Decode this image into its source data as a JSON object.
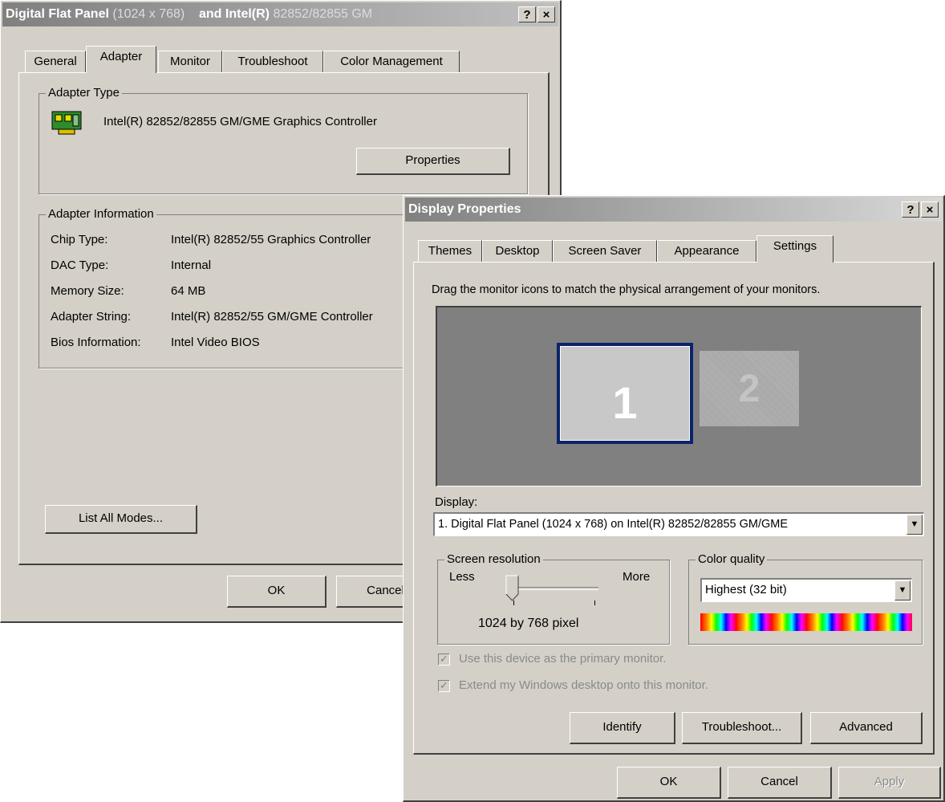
{
  "back_window": {
    "title_main": "Digital Flat Panel",
    "title_res": "(1024 x 768)",
    "title_and": "and Intel(R)",
    "title_chip": "82852/82855 GM",
    "help_btn": "?",
    "close_btn": "×",
    "tabs": [
      {
        "label": "General"
      },
      {
        "label": "Adapter"
      },
      {
        "label": "Monitor"
      },
      {
        "label": "Troubleshoot"
      },
      {
        "label": "Color Management"
      }
    ],
    "adapter_type_label": "Adapter Type",
    "adapter_name": "Intel(R) 82852/82855 GM/GME Graphics Controller",
    "properties_button": "Properties",
    "adapter_info_label": "Adapter Information",
    "info": [
      {
        "key": "Chip Type:",
        "value": "Intel(R) 82852/55 Graphics Controller"
      },
      {
        "key": "DAC Type:",
        "value": "Internal"
      },
      {
        "key": "Memory Size:",
        "value": "64 MB"
      },
      {
        "key": "Adapter String:",
        "value": "Intel(R) 82852/55 GM/GME Controller"
      },
      {
        "key": "Bios Information:",
        "value": "Intel Video BIOS"
      }
    ],
    "list_modes_button": "List All Modes...",
    "ok_button": "OK",
    "cancel_button": "Cancel"
  },
  "front_window": {
    "title": "Display Properties",
    "help_btn": "?",
    "close_btn": "×",
    "tabs": [
      {
        "label": "Themes"
      },
      {
        "label": "Desktop"
      },
      {
        "label": "Screen Saver"
      },
      {
        "label": "Appearance"
      },
      {
        "label": "Settings"
      }
    ],
    "instruction": "Drag the monitor icons to match the physical arrangement of your monitors.",
    "monitor_1": "1",
    "monitor_2": "2",
    "display_label": "Display:",
    "display_value": "1. Digital Flat Panel  (1024 x 768)  on Intel(R) 82852/82855 GM/GME",
    "screen_res_label": "Screen resolution",
    "less_label": "Less",
    "more_label": "More",
    "resolution_value": "1024 by 768 pixel",
    "color_quality_label": "Color quality",
    "color_quality_value": "Highest (32 bit)",
    "primary_checkbox": "Use this device as the primary monitor.",
    "extend_checkbox": "Extend my Windows desktop onto this monitor.",
    "identify_button": "Identify",
    "troubleshoot_button": "Troubleshoot...",
    "advanced_button": "Advanced",
    "ok_button": "OK",
    "cancel_button": "Cancel",
    "apply_button": "Apply"
  },
  "colors": {
    "face": "#d4d0c8",
    "monitor_area": "#808080",
    "selected_border": "#0a246a"
  }
}
